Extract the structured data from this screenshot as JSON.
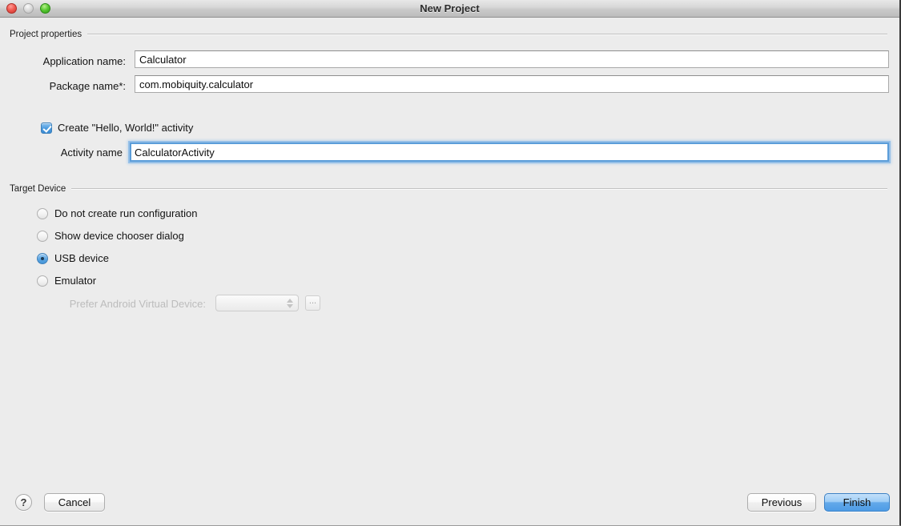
{
  "window": {
    "title": "New Project",
    "traffic_lights": [
      "close-button",
      "minimize-button",
      "zoom-button"
    ]
  },
  "groups": {
    "project_properties": {
      "title": "Project properties",
      "fields": [
        {
          "label": "Application name:",
          "value": "Calculator"
        },
        {
          "label": "Package name*:",
          "value": "com.mobiquity.calculator"
        }
      ],
      "checkbox": {
        "label": "Create \"Hello, World!\" activity",
        "checked": true
      },
      "activity": {
        "label": "Activity name",
        "value": "CalculatorActivity",
        "focused": true
      }
    },
    "target_device": {
      "title": "Target Device",
      "options": [
        {
          "label": "Do not create run configuration",
          "selected": false
        },
        {
          "label": "Show device chooser dialog",
          "selected": false
        },
        {
          "label": "USB device",
          "selected": true
        },
        {
          "label": "Emulator",
          "selected": false
        }
      ],
      "avd": {
        "label": "Prefer Android Virtual Device:",
        "value": "",
        "browse_label": "...",
        "disabled": true
      }
    }
  },
  "footer": {
    "help_label": "?",
    "cancel_label": "Cancel",
    "previous_label": "Previous",
    "finish_label": "Finish"
  },
  "colors": {
    "accent": "#4a9ade",
    "default_button": "#62a9ea",
    "focus_ring": "#5b9dd9",
    "window_bg": "#ececec",
    "disabled_text": "#bcbcbc"
  }
}
